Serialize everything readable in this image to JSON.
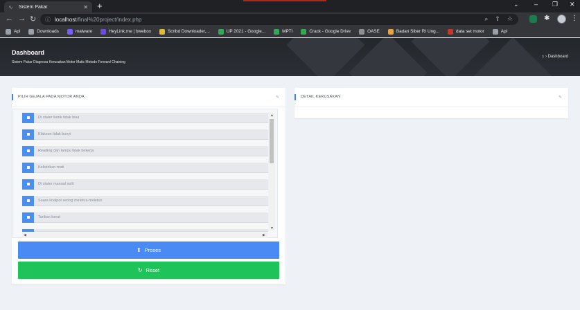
{
  "browser": {
    "tab_title": "Sistem Pakar",
    "url_host": "localhost",
    "url_path": "/final%20project/index.php"
  },
  "bookmarks": [
    {
      "label": "Apl",
      "icon": "apps-grid-icon",
      "color": "#9aa0a6"
    },
    {
      "label": "Downloads",
      "icon": "download-icon",
      "color": "#9aa0a6"
    },
    {
      "label": "malware",
      "icon": "shield-icon",
      "color": "#7b5cff"
    },
    {
      "label": "HeyLink.me | bwebox",
      "icon": "link-icon",
      "color": "#6a4dd8"
    },
    {
      "label": "Scribd Downloader,...",
      "icon": "scribd-icon",
      "color": "#e0b93a"
    },
    {
      "label": "UP 2021 - Google...",
      "icon": "drive-icon",
      "color": "#34a853"
    },
    {
      "label": "MPTI",
      "icon": "drive-icon",
      "color": "#34a853"
    },
    {
      "label": "Crack - Google Drive",
      "icon": "drive-icon",
      "color": "#34a853"
    },
    {
      "label": "OASE",
      "icon": "oase-icon",
      "color": "#8e8e93"
    },
    {
      "label": "Badan Siber RI Ung...",
      "icon": "badan-icon",
      "color": "#e8a33d"
    },
    {
      "label": "data set motor",
      "icon": "motor-icon",
      "color": "#c0392b"
    },
    {
      "label": "Apl",
      "icon": "apps-grid-icon",
      "color": "#9aa0a6"
    }
  ],
  "header": {
    "title": "Dashboard",
    "subtitle": "Sistem Pakar Diagnosa Kerusakan Motor Matic Metode Forward Chaining",
    "breadcrumb": "Dashboard"
  },
  "left_card": {
    "title": "PILIH GEJALA PADA MOTOR ANDA",
    "symptoms": [
      "Di stater listrik tidak bisa",
      "Klakson tidak bunyi",
      "Reading dan lampu tidak bekerja",
      "Kelistrikan mati",
      "Di stater manual sulit",
      "Suara knalpot sering meletus-meletus",
      "Tarikan berat"
    ],
    "process_label": "Proses",
    "reset_label": "Reset"
  },
  "right_card": {
    "title": "DETAIL KERUSAKAN"
  },
  "colors": {
    "accent_blue": "#4a8af4",
    "reset_green": "#1ec45a",
    "checkbox_blue": "#4c8df0",
    "header_dark": "#24272c"
  }
}
